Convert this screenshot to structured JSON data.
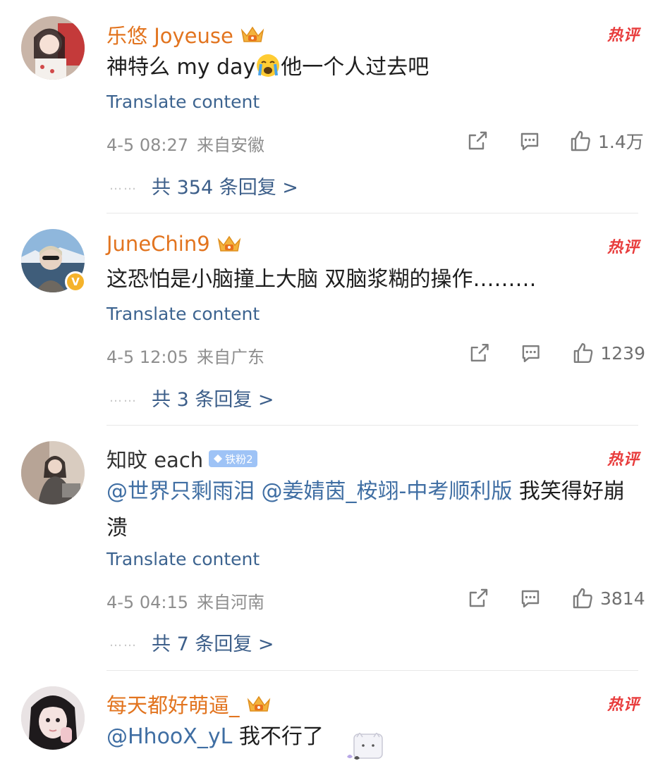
{
  "comments": [
    {
      "username": "乐悠 Joyeuse",
      "username_color": "#e2741f",
      "has_crown": true,
      "hot_label": "热评",
      "content_before": "神特么 my day",
      "content_emoji": "crying-face-emoji",
      "content_after": "他一个人过去吧",
      "translate": "Translate content",
      "date": "4-5 08:27",
      "location": "来自安徽",
      "likes": "1.4万",
      "replies": "共 354 条回复 >"
    },
    {
      "username": "JuneChin9",
      "username_color": "#e2741f",
      "has_crown": true,
      "verified": true,
      "hot_label": "热评",
      "content": "这恐怕是小脑撞上大脑 双脑浆糊的操作………",
      "translate": "Translate content",
      "date": "4-5 12:05",
      "location": "来自广东",
      "likes": "1239",
      "replies": "共 3 条回复 >"
    },
    {
      "username": "知旼 each",
      "fan_badge": "铁粉2",
      "hot_label": "热评",
      "mention1": "@世界只剩雨泪",
      "mention2": "@姜婧茵_桉翊-中考顺利版",
      "content_tail": "我笑得好崩溃",
      "translate": "Translate content",
      "date": "4-5 04:15",
      "location": "来自河南",
      "likes": "3814",
      "replies": "共 7 条回复 >"
    },
    {
      "username": "每天都好萌逼_",
      "has_crown": true,
      "hot_label": "热评",
      "mention": "@HhooX_yL",
      "content_tail": "我不行了"
    }
  ],
  "reply_dots": "……",
  "colors": {
    "link": "#3d6490",
    "hot": "#e83c3c",
    "meta": "#8e8e8e"
  }
}
